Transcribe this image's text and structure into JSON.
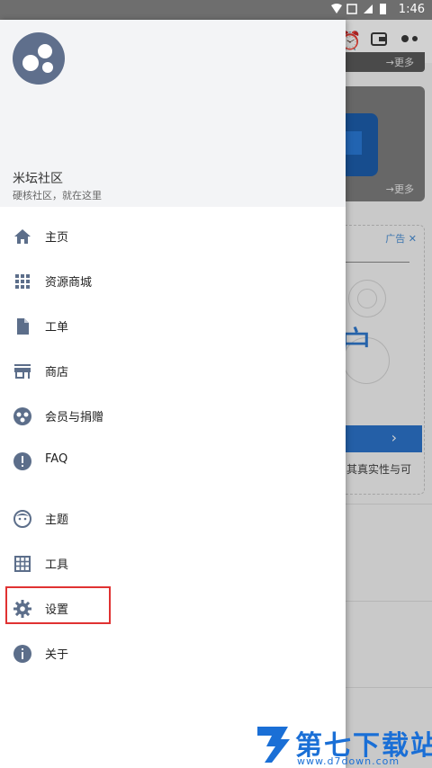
{
  "status_bar": {
    "time": "1:46"
  },
  "background": {
    "more_label": "→更多",
    "ad_label": "广告",
    "ad_big_text": "户",
    "ad_footer_text": "其真实性与可"
  },
  "drawer": {
    "community_name": "米坛社区",
    "tagline": "硬核社区，就在这里",
    "menu": [
      {
        "label": "主页",
        "icon": "home-icon"
      },
      {
        "label": "资源商城",
        "icon": "grid-icon"
      },
      {
        "label": "工单",
        "icon": "document-icon"
      },
      {
        "label": "商店",
        "icon": "store-icon"
      },
      {
        "label": "会员与捐赠",
        "icon": "members-icon"
      },
      {
        "label": "FAQ",
        "icon": "alert-circle-icon"
      },
      {
        "label": "主题",
        "icon": "face-icon"
      },
      {
        "label": "工具",
        "icon": "table-icon"
      },
      {
        "label": "设置",
        "icon": "gear-icon"
      },
      {
        "label": "关于",
        "icon": "info-icon"
      }
    ],
    "highlighted_item": "设置"
  },
  "watermark": {
    "title": "第七下载站",
    "url": "www.d7down.com"
  },
  "colors": {
    "icon": "#5c6e8a",
    "accent": "#1a6fd6",
    "highlight": "#e03232"
  }
}
